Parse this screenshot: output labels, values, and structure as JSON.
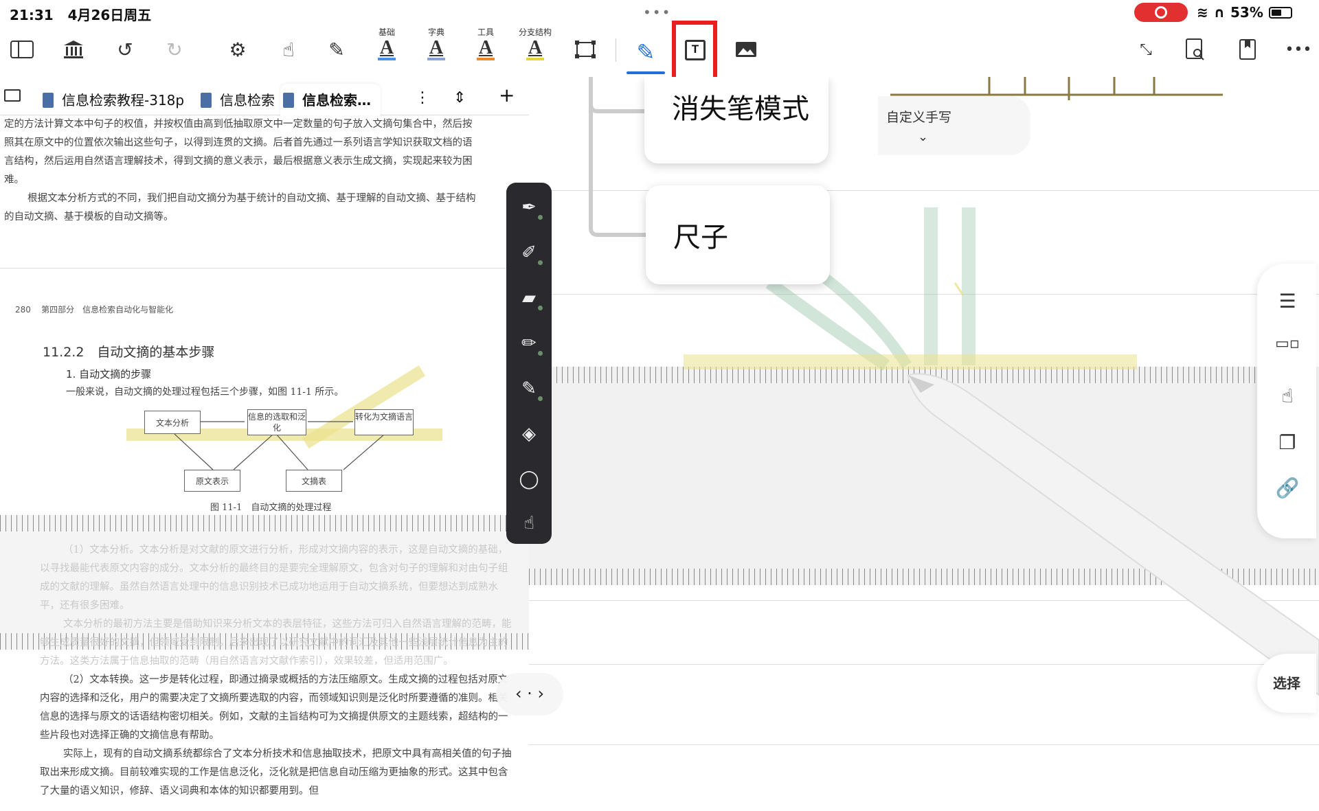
{
  "status_bar": {
    "time": "21:31",
    "date": "4月26日周五",
    "dots": "•••",
    "battery": "53%"
  },
  "toolbar": {
    "font_buttons": [
      {
        "caption": "基础",
        "letter": "A",
        "underline_color": "#4a90e2"
      },
      {
        "caption": "字典",
        "letter": "A",
        "underline_color": "#8aa0d8"
      },
      {
        "caption": "工具",
        "letter": "A",
        "underline_color": "#e88a2a"
      },
      {
        "caption": "分支结构",
        "letter": "A",
        "underline_color": "#e6d43a"
      }
    ],
    "textbox_icon": "T",
    "more": "•••"
  },
  "tabs": {
    "items": [
      {
        "label": "信息检索教程-318p"
      },
      {
        "label": "信息检索"
      },
      {
        "label": "信息检索…"
      }
    ],
    "add": "+",
    "menu": "⋮",
    "sort": "⇕"
  },
  "document": {
    "para1": "定的方法计算文本中句子的权值，并按权值由高到低抽取原文中一定数量的句子放入文摘句集合中，然后按照其在原文中的位置依次输出这些句子，以得到连贯的文摘。后者首先通过一系列语言学知识获取文档的语言结构，然后运用自然语言理解技术，得到文摘的意义表示，最后根据意义表示生成文摘，实现起来较为困难。",
    "para2": "根据文本分析方式的不同，我们把自动文摘分为基于统计的自动文摘、基于理解的自动文摘、基于结构的自动文摘、基于模板的自动文摘等。",
    "page_number": "280",
    "page_header": "第四部分　信息检索自动化与智能化",
    "section_title": "11.2.2　自动文摘的基本步骤",
    "subsection": "1. 自动文摘的步骤",
    "intro": "一般来说，自动文摘的处理过程包括三个步骤，如图 11-1 所示。",
    "figure": {
      "box1": "文本分析",
      "box2": "信息的选取和泛化",
      "box3": "转化为文摘语言",
      "box4": "原文表示",
      "box5": "文摘表",
      "caption": "图 11-1　自动文摘的处理过程"
    },
    "ghost1": "（1）文本分析。文本分析是对文献的原文进行分析，形成对文摘内容的表示，这是自动文摘的基础，以寻找最能代表原文内容的成分。文本分析的最终目的是要完全理解原文，包含对句子的理解和对由句子组成的文献的理解。虽然自然语言处理中的信息识别技术已成功地运用于自动文摘系统，但要想达到成熟水平，还有很多困难。",
    "ghost2": "文本分析的最初方法主要是借助知识来分析文本的表层特征，这些方法可归入自然语言理解的范畴，能够生成质量很好的文摘，但领域受到限制。后来出现了以研究文献中的词汇及其他一些浅层统计信息为主的方法。这类方法属于信息抽取的范畴（用自然语言对文献作索引），效果较差，但适用范围广。",
    "para3": "（2）文本转换。这一步是转化过程，即通过摘录或概括的方法压缩原文。生成文摘的过程包括对原文内容的选择和泛化，用户的需要决定了文摘所要选取的内容，而领域知识则是泛化时所要遵循的准则。相关信息的选择与原文的话语结构密切相关。例如，文献的主旨结构可为文摘提供原文的主题线索，超结构的一些片段也对选择正确的文摘信息有帮助。",
    "para4": "实际上，现有的自动文摘系统都综合了文本分析技术和信息抽取技术，把原文中具有高相关值的句子抽取出来形成文摘。目前较难实现的工作是信息泛化，泛化就是把信息自动压缩为更抽象的形式。这其中包含了大量的语义知识，修辞、语义词典和本体的知识都要用到。但"
  },
  "canvas": {
    "card1": "消失笔模式",
    "card2": "尺子",
    "custom_label": "自定义手写",
    "select_label": "选择"
  },
  "nav": {
    "arrows": "‹ · ›"
  },
  "colors": {
    "accent": "#1e6fd9",
    "highlight_frame": "#e8201c",
    "record": "#e23030",
    "pen_toolbar": "#2a2a2e",
    "highlighter": "#ebe18c"
  }
}
